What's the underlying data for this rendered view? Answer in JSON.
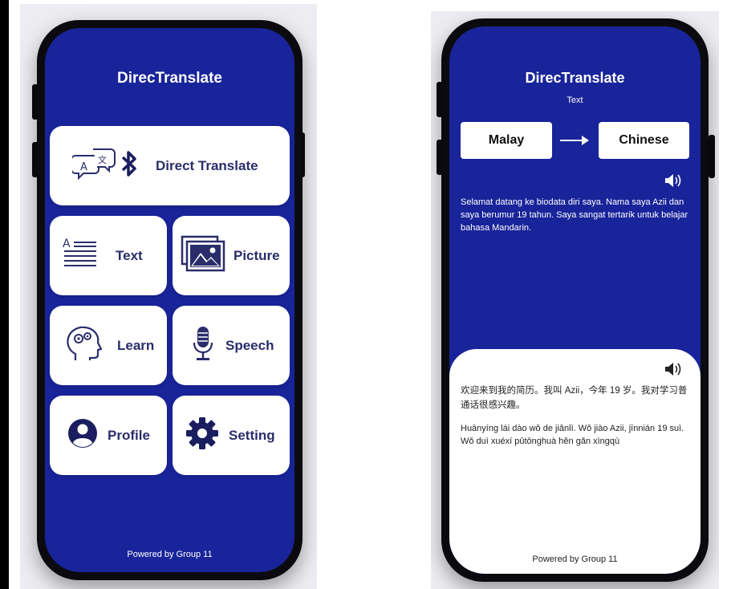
{
  "left_phone": {
    "app_title": "DirecTranslate",
    "menu": {
      "direct_translate": "Direct Translate",
      "text": "Text",
      "picture": "Picture",
      "learn": "Learn",
      "speech": "Speech",
      "profile": "Profile",
      "setting": "Setting"
    },
    "footer": "Powered by Group 11",
    "icons": [
      "translate-bubbles-icon",
      "bluetooth-icon",
      "text-lines-icon",
      "picture-icon",
      "head-gears-icon",
      "microphone-icon",
      "profile-icon",
      "gear-icon"
    ]
  },
  "right_phone": {
    "app_title": "DirecTranslate",
    "subtitle": "Text",
    "source_language": "Malay",
    "target_language": "Chinese",
    "source_text": "Selamat datang ke biodata diri saya. Nama saya Azii dan saya berumur 19 tahun. Saya sangat tertarik untuk belajar bahasa Mandarin.",
    "translation_text": "欢迎来到我的简历。我叫 Azii，今年 19 岁。我对学习普通话很感兴趣。",
    "pinyin_text": "Huānyíng lái dào wǒ de jiǎnlì. Wǒ jiào Azii, jīnnián 19 suì. Wǒ duì xuéxí pǔtōnghuà hěn gǎn xìngqù",
    "footer": "Powered by Group 11",
    "icons": [
      "speaker-icon",
      "arrow-right-icon"
    ]
  },
  "colors": {
    "screen_blue": "#19249a",
    "card_white": "#ffffff",
    "text_navy": "#2a2d6a",
    "frame": "#0b0b0f"
  }
}
